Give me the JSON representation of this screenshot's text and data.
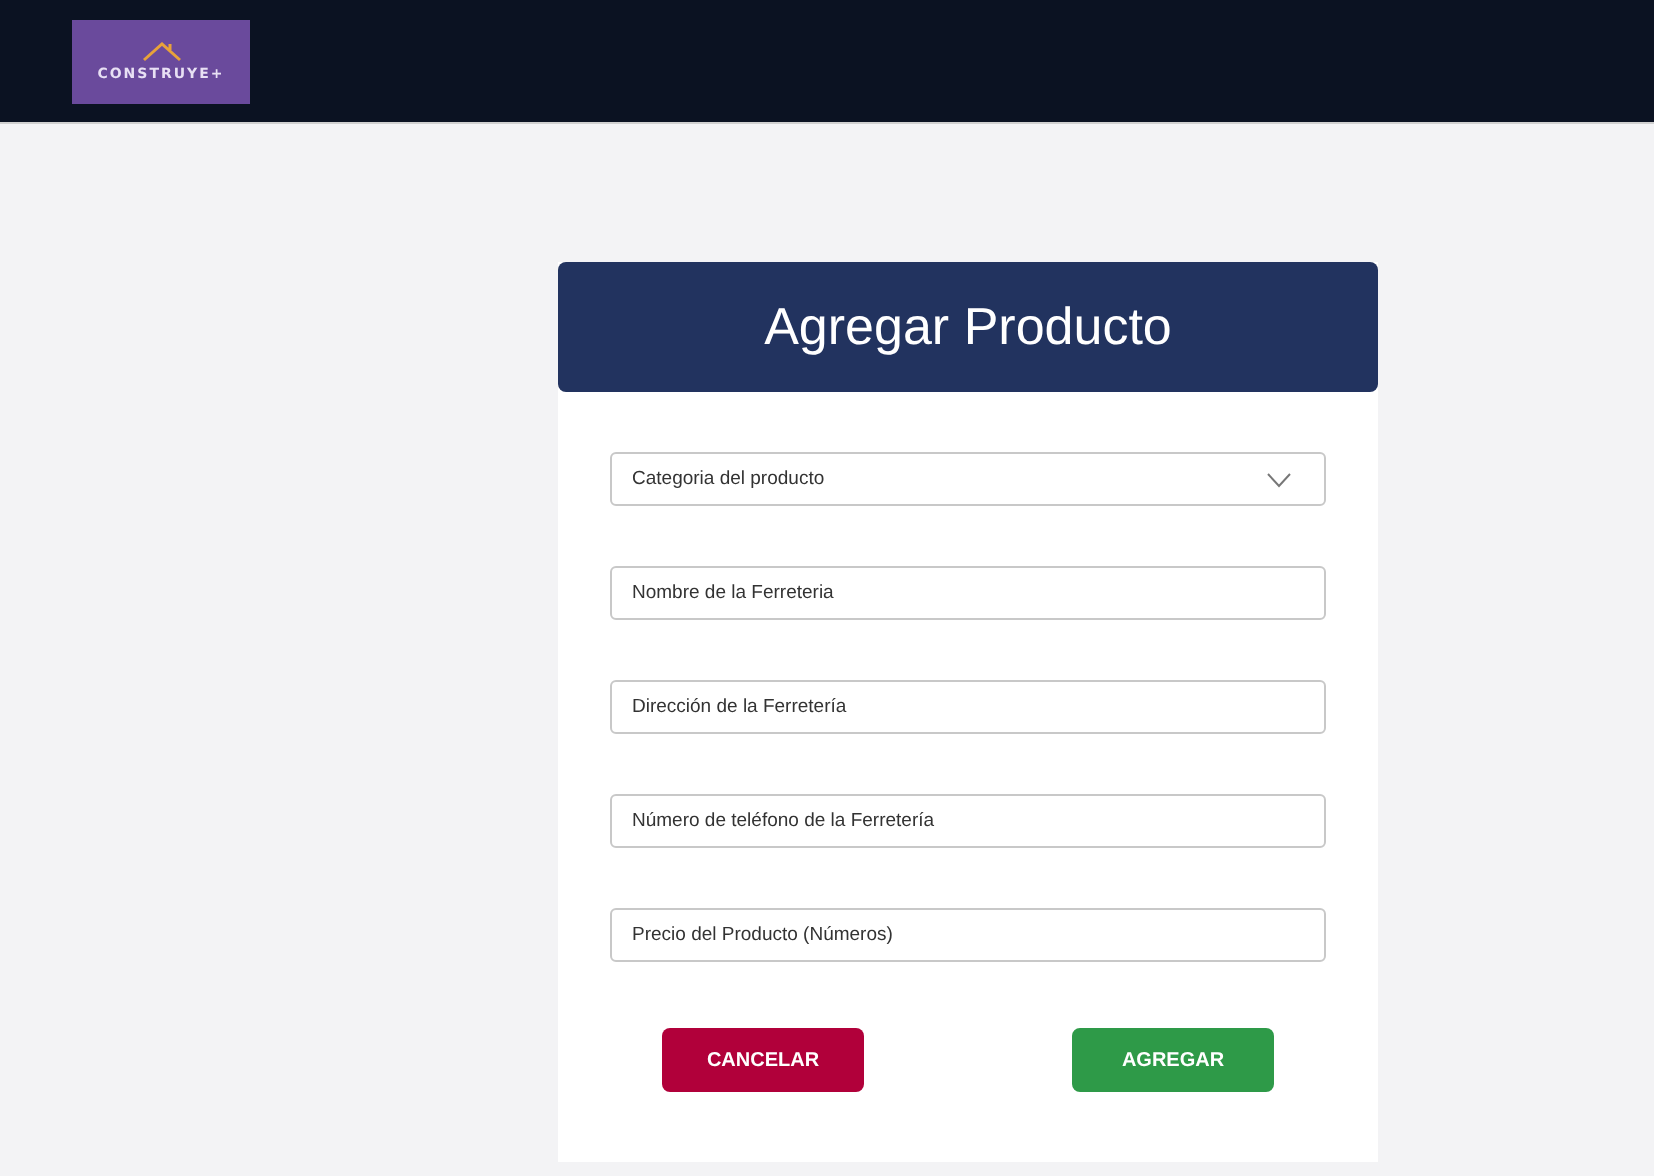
{
  "header": {
    "logo_text": "CONSTRUYE+"
  },
  "form": {
    "title": "Agregar Producto",
    "fields": [
      {
        "kind": "select",
        "placeholder": "Categoria del producto"
      },
      {
        "kind": "text",
        "placeholder": "Nombre de la Ferreteria"
      },
      {
        "kind": "text",
        "placeholder": "Dirección de la Ferretería"
      },
      {
        "kind": "text",
        "placeholder": "Número de teléfono de la Ferretería"
      },
      {
        "kind": "text",
        "placeholder": "Precio del Producto (Números)"
      }
    ],
    "buttons": [
      {
        "kind": "cancel",
        "label": "CANCELAR"
      },
      {
        "kind": "confirm",
        "label": "AGREGAR"
      }
    ]
  }
}
